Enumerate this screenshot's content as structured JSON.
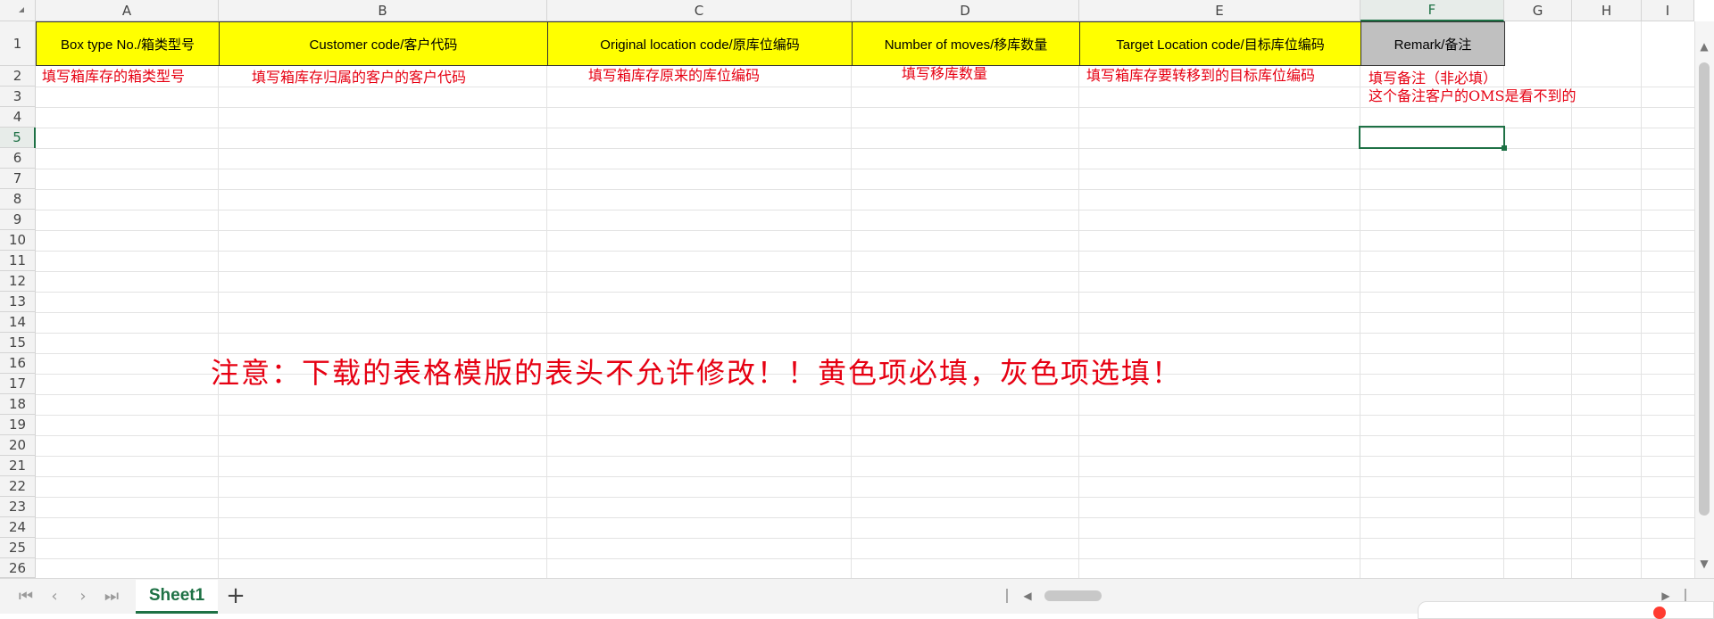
{
  "sheet": {
    "columns": [
      "A",
      "B",
      "C",
      "D",
      "E",
      "F",
      "G",
      "H",
      "I"
    ],
    "rows": [
      "1",
      "2",
      "3",
      "4",
      "5",
      "6",
      "7",
      "8",
      "9",
      "10",
      "11",
      "12",
      "13",
      "14",
      "15",
      "16",
      "17",
      "18",
      "19",
      "20",
      "21",
      "22",
      "23",
      "24",
      "25",
      "26"
    ],
    "active_column": "F",
    "active_row": "5"
  },
  "headers": [
    "Box type No./箱类型号",
    "Customer code/客户代码",
    "Original location code/原库位编码",
    "Number of moves/移库数量",
    "Target Location code/目标库位编码",
    "Remark/备注"
  ],
  "notes": {
    "a2": "填写箱库存的箱类型号",
    "b2": "填写箱库存归属的客户的客户代码",
    "c2": "填写箱库存原来的库位编码",
    "d2": "填写移库数量",
    "e2": "填写箱库存要转移到的目标库位编码",
    "f2": "填写备注（非必填）",
    "f3": "这个备注客户的OMS是看不到的",
    "warning": "注意：下载的表格模版的表头不允许修改！！黄色项必填，灰色项选填！"
  },
  "tabs": {
    "active_sheet": "Sheet1",
    "add_label": "+"
  },
  "icons": {
    "first": "first-sheet-icon",
    "prev": "prev-sheet-icon",
    "next": "next-sheet-icon",
    "last": "last-sheet-icon"
  },
  "colors": {
    "required_header": "#ffff00",
    "optional_header": "#c0c0c0",
    "note_text": "#e60012",
    "accent": "#1e7145"
  }
}
